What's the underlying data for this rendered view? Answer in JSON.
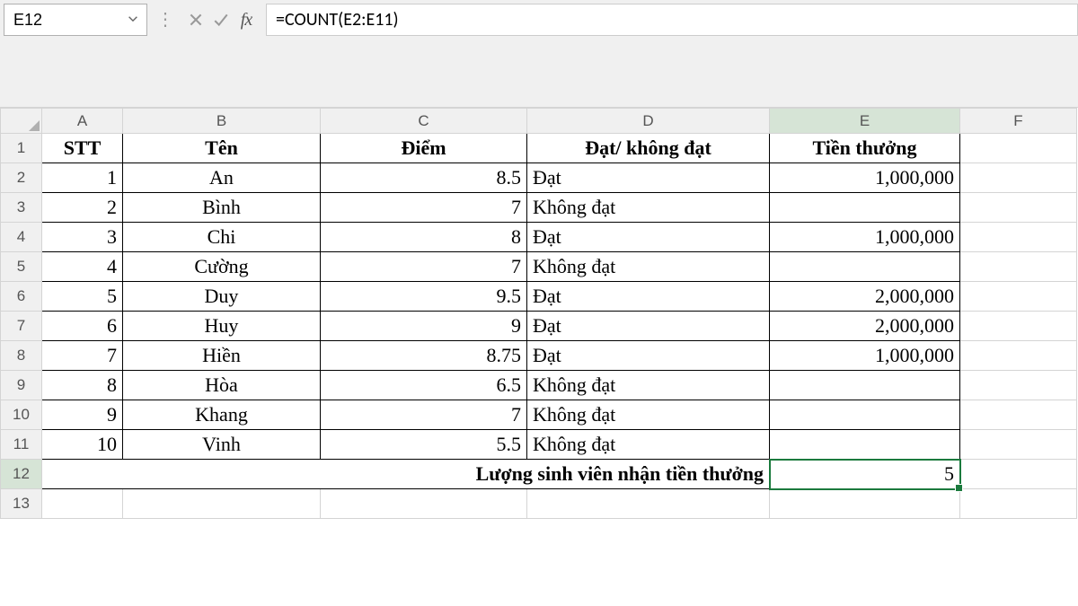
{
  "formula_bar": {
    "cell_ref": "E12",
    "formula": "=COUNT(E2:E11)"
  },
  "columns": [
    "A",
    "B",
    "C",
    "D",
    "E",
    "F"
  ],
  "row_numbers": [
    "1",
    "2",
    "3",
    "4",
    "5",
    "6",
    "7",
    "8",
    "9",
    "10",
    "11",
    "12",
    "13"
  ],
  "headers": {
    "stt": "STT",
    "ten": "Tên",
    "diem": "Điểm",
    "dat": "Đạt/ không đạt",
    "tien": "Tiền thưởng"
  },
  "rows": [
    {
      "stt": "1",
      "ten": "An",
      "diem": "8.5",
      "dat": "Đạt",
      "tien": "1,000,000"
    },
    {
      "stt": "2",
      "ten": "Bình",
      "diem": "7",
      "dat": "Không đạt",
      "tien": ""
    },
    {
      "stt": "3",
      "ten": "Chi",
      "diem": "8",
      "dat": "Đạt",
      "tien": "1,000,000"
    },
    {
      "stt": "4",
      "ten": "Cường",
      "diem": "7",
      "dat": "Không đạt",
      "tien": ""
    },
    {
      "stt": "5",
      "ten": "Duy",
      "diem": "9.5",
      "dat": "Đạt",
      "tien": "2,000,000"
    },
    {
      "stt": "6",
      "ten": "Huy",
      "diem": "9",
      "dat": "Đạt",
      "tien": "2,000,000"
    },
    {
      "stt": "7",
      "ten": "Hiền",
      "diem": "8.75",
      "dat": "Đạt",
      "tien": "1,000,000"
    },
    {
      "stt": "8",
      "ten": "Hòa",
      "diem": "6.5",
      "dat": "Không đạt",
      "tien": ""
    },
    {
      "stt": "9",
      "ten": "Khang",
      "diem": "7",
      "dat": "Không đạt",
      "tien": ""
    },
    {
      "stt": "10",
      "ten": "Vinh",
      "diem": "5.5",
      "dat": "Không đạt",
      "tien": ""
    }
  ],
  "summary": {
    "label": "Lượng sinh viên nhận tiền thưởng",
    "value": "5"
  }
}
